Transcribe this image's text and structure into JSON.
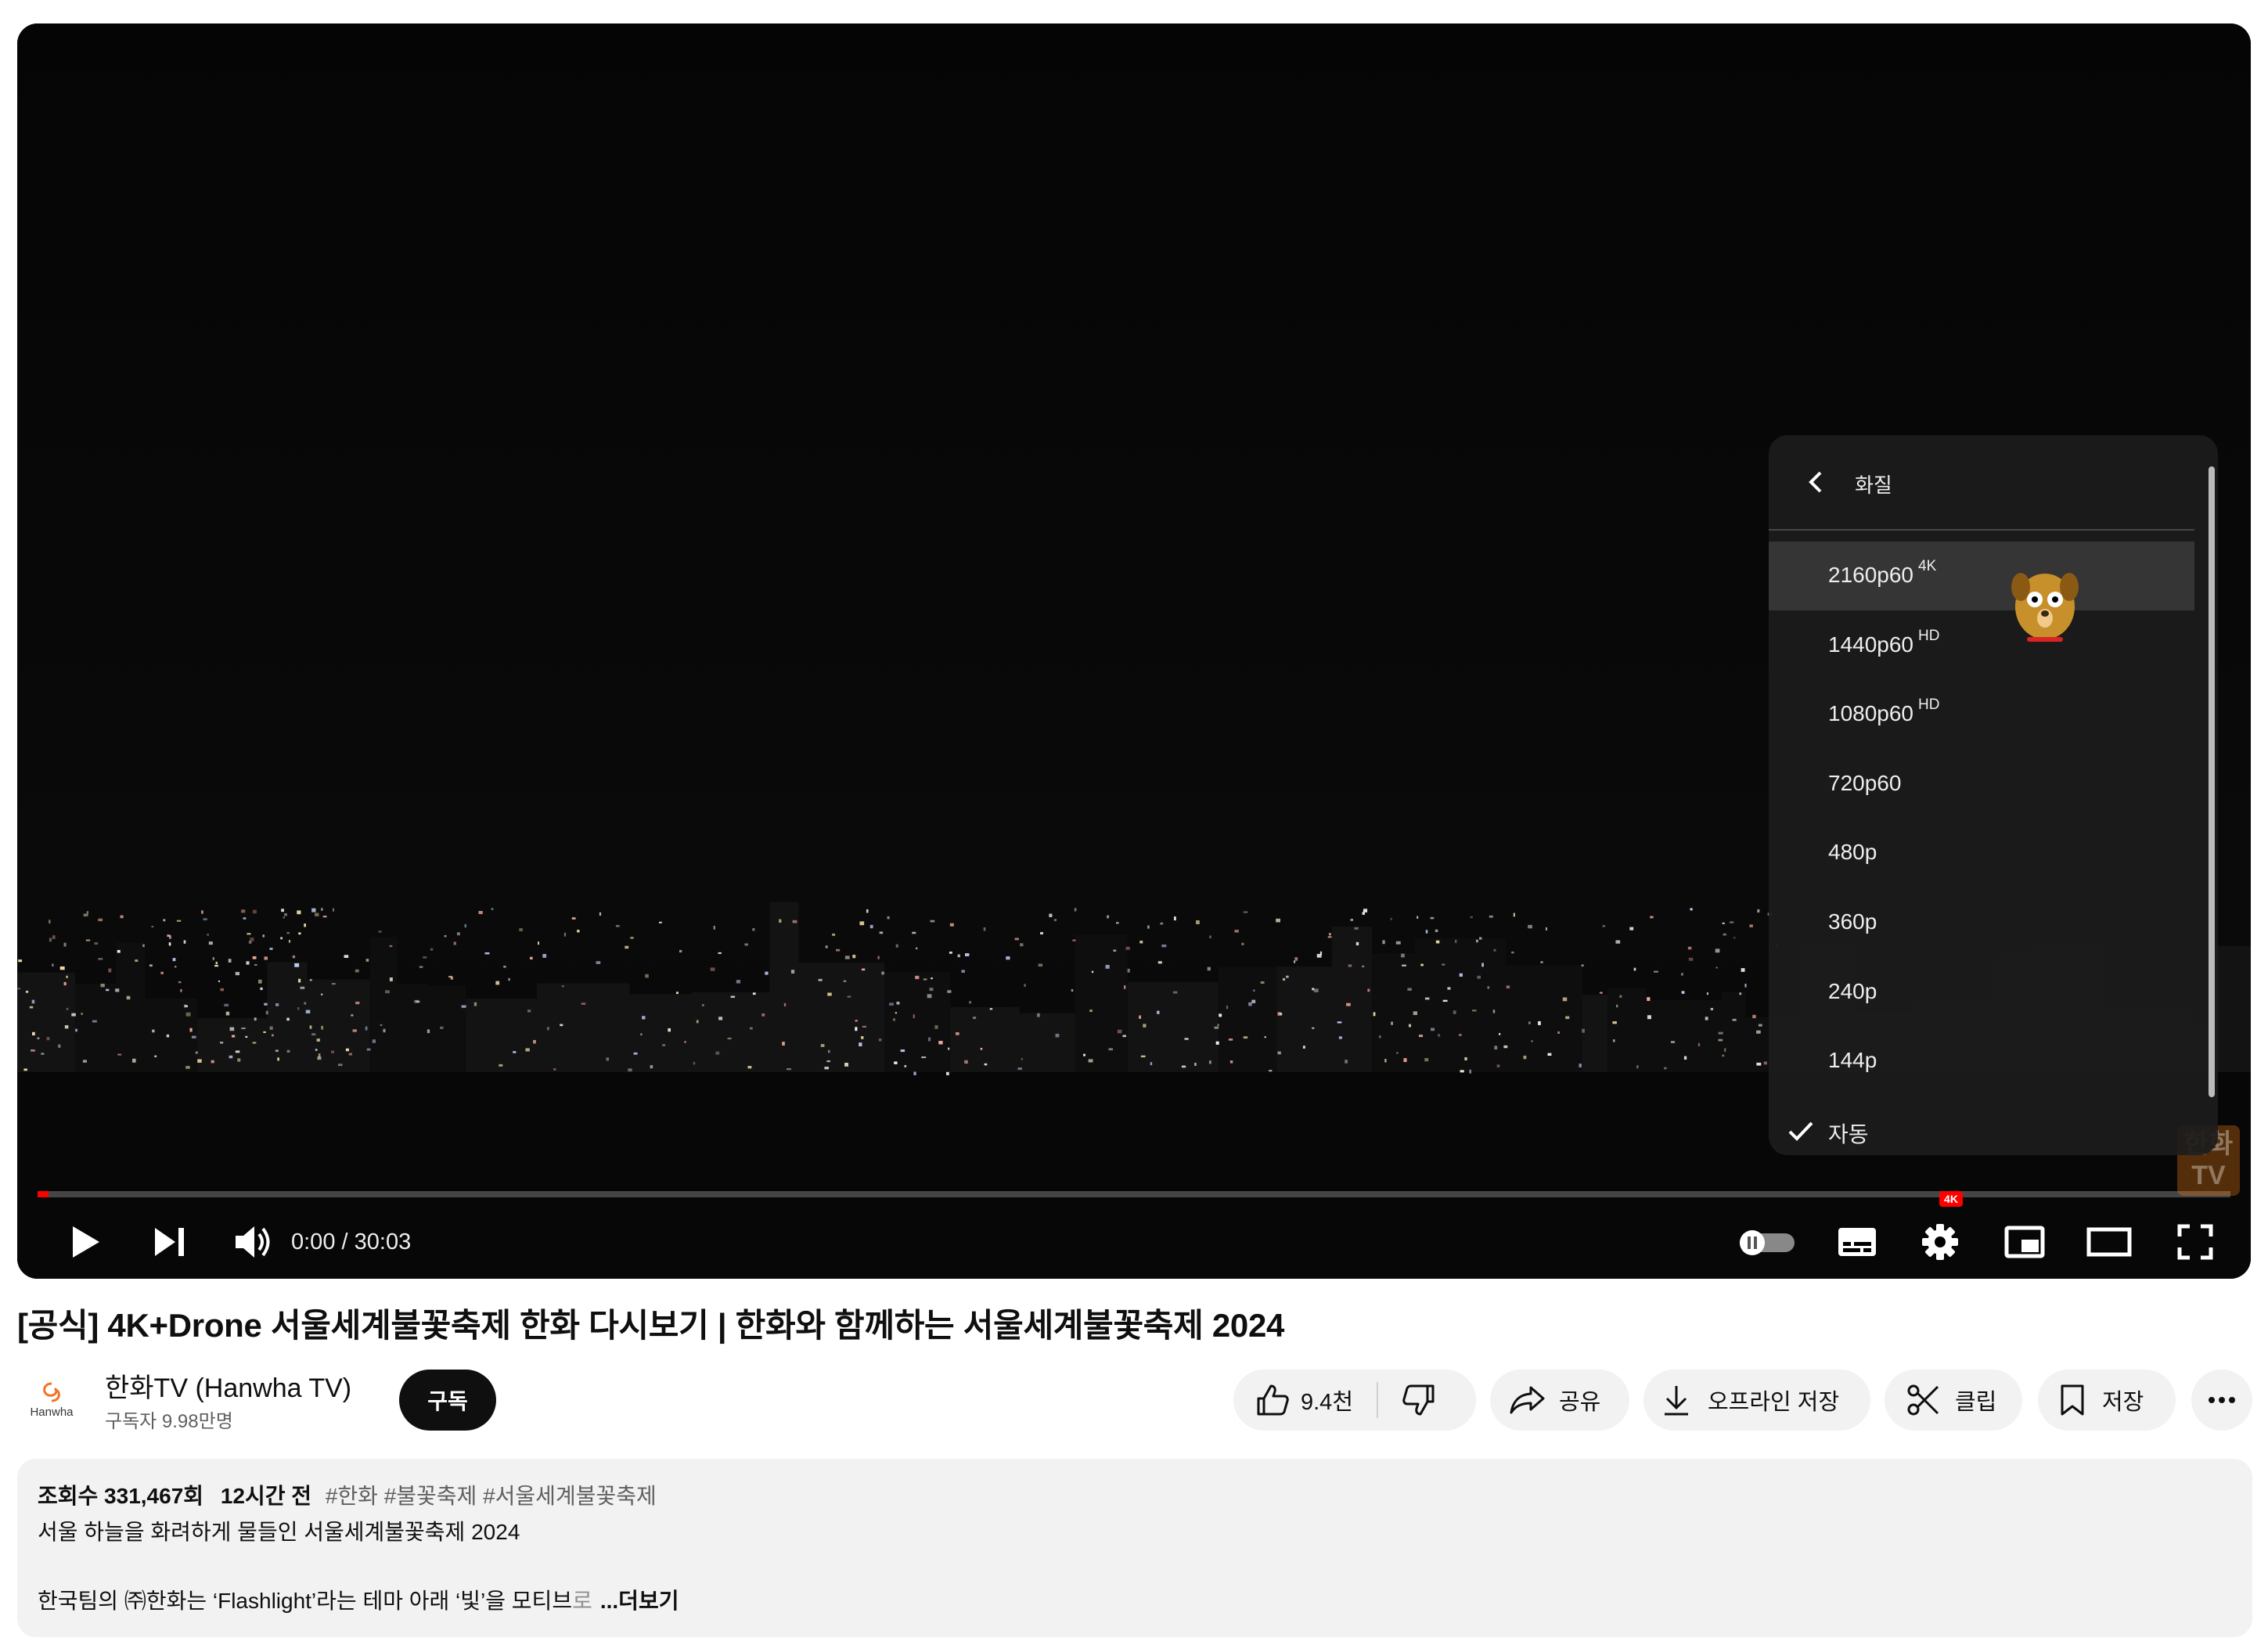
{
  "player": {
    "time_current": "0:00",
    "time_separator": " / ",
    "time_total": "30:03",
    "progress_fraction": 0.005,
    "settings_badge": "4K",
    "watermark": "한화\nTV"
  },
  "quality_menu": {
    "title": "화질",
    "options": [
      {
        "label": "2160p60",
        "tag": "4K",
        "highlighted": true,
        "checked": false
      },
      {
        "label": "1440p60",
        "tag": "HD",
        "highlighted": false,
        "checked": false
      },
      {
        "label": "1080p60",
        "tag": "HD",
        "highlighted": false,
        "checked": false
      },
      {
        "label": "720p60",
        "tag": "",
        "highlighted": false,
        "checked": false
      },
      {
        "label": "480p",
        "tag": "",
        "highlighted": false,
        "checked": false
      },
      {
        "label": "360p",
        "tag": "",
        "highlighted": false,
        "checked": false
      },
      {
        "label": "240p",
        "tag": "",
        "highlighted": false,
        "checked": false
      },
      {
        "label": "144p",
        "tag": "",
        "highlighted": false,
        "checked": false
      },
      {
        "label": "자동",
        "tag": "",
        "highlighted": false,
        "checked": true
      }
    ]
  },
  "video": {
    "title": "[공식] 4K+Drone 서울세계불꽃축제 한화 다시보기 | 한화와 함께하는 서울세계불꽃축제 2024"
  },
  "channel": {
    "logo_text": "Hanwha",
    "name": "한화TV (Hanwha TV)",
    "subscribers": "구독자 9.98만명",
    "subscribe_label": "구독"
  },
  "actions": {
    "like_count": "9.4천",
    "share_label": "공유",
    "offline_label": "오프라인 저장",
    "clip_label": "클립",
    "save_label": "저장"
  },
  "description": {
    "views": "조회수 331,467회",
    "ago": "12시간 전",
    "tags": "#한화 #불꽃축제 #서울세계불꽃축제",
    "line1": "서울 하늘을 화려하게 물들인 서울세계불꽃축제 2024",
    "line2_main": "한국팀의 ㈜한화는 ‘Flashlight’라는 테마 아래 ‘빛’을 모티브",
    "line2_fade": "로",
    "more_label": "...더보기"
  },
  "colors": {
    "progress": "#ff0000",
    "subscribe_bg": "#0f0f0f",
    "pill_bg": "#f2f2f2",
    "player_bg": "#000000"
  },
  "icons": [
    "play-icon",
    "next-icon",
    "volume-icon",
    "autoplay-toggle-icon",
    "subtitles-icon",
    "settings-gear-icon",
    "miniplayer-icon",
    "theater-mode-icon",
    "fullscreen-icon",
    "back-chevron-icon",
    "checkmark-icon",
    "thumbs-up-icon",
    "thumbs-down-icon",
    "share-arrow-icon",
    "download-icon",
    "scissors-icon",
    "bookmark-icon",
    "more-dots-icon"
  ]
}
